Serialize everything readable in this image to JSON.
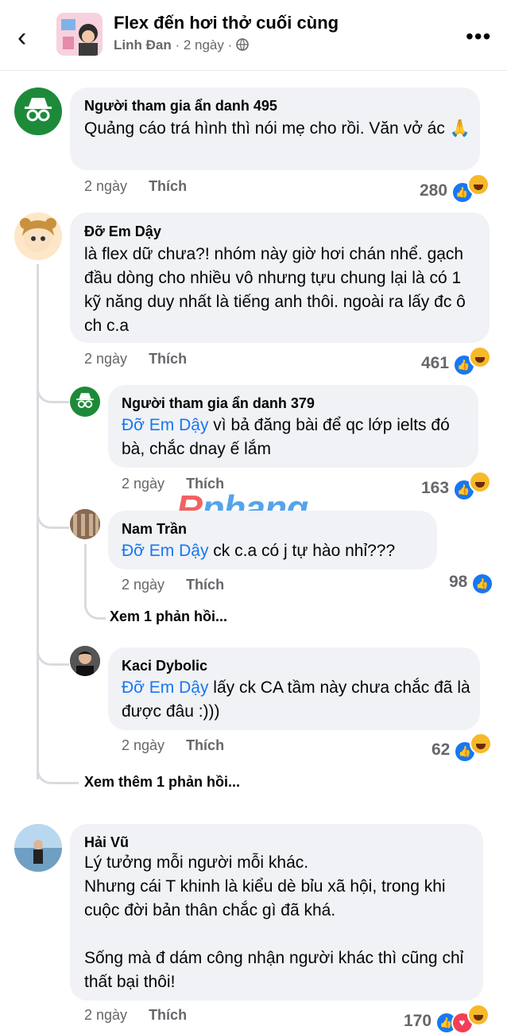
{
  "header": {
    "group_title": "Flex đến hơi thở cuối cùng",
    "author": "Linh Đan",
    "time": "· 2 ngày ·",
    "back_icon": "back-icon",
    "more_icon": "more-icon"
  },
  "comments": [
    {
      "name": "Người tham gia ẩn danh 495",
      "text": "Quảng cáo trá hình thì nói mẹ cho rồi. Văn vở ác 🙏",
      "time": "2 ngày",
      "like_label": "Thích",
      "count": "280"
    },
    {
      "name": "Đỡ Em Dậy",
      "text": "là flex dữ chưa?! nhóm này giờ hơi chán nhể. gạch đầu dòng cho nhiều vô nhưng tựu chung lại là có 1 kỹ năng duy nhất là tiếng anh thôi. ngoài ra lấy đc ô ch c.a",
      "time": "2 ngày",
      "like_label": "Thích",
      "count": "461"
    },
    {
      "name": "Người tham gia ẩn danh 379",
      "mention": "Đỡ Em Dậy",
      "text": " vì bả đăng bài để qc lớp ielts đó bà, chắc dnay ế lắm",
      "time": "2 ngày",
      "like_label": "Thích",
      "count": "163"
    },
    {
      "name": "Nam Trần",
      "mention": "Đỡ Em Dậy",
      "text": " ck c.a có j tự hào nhỉ???",
      "time": "2 ngày",
      "like_label": "Thích",
      "count": "98",
      "see_replies": "Xem 1 phản hồi..."
    },
    {
      "name": "Kaci Dybolic",
      "mention": "Đỡ Em Dậy",
      "text": " lấy ck CA tầm này chưa chắc đã là được đâu :)))",
      "time": "2 ngày",
      "like_label": "Thích",
      "count": "62"
    },
    {
      "see_more_replies": "Xem thêm 1 phản hồi..."
    },
    {
      "name": "Hải Vũ",
      "text_lines": [
        "Lý tưởng mỗi người mỗi khác.",
        "Nhưng cái T khinh là kiểu dè bỉu xã hội, trong khi cuộc đời bản thân chắc gì đã khá.",
        "",
        "Sống mà đ dám công nhận người khác thì cũng chỉ thất bại thôi!"
      ],
      "time": "2 ngày",
      "like_label": "Thích",
      "count": "170"
    }
  ],
  "watermark": {
    "first": "R",
    "rest": "phang"
  },
  "colors": {
    "link": "#1877f2",
    "bubble": "#f0f2f5",
    "meta": "#65676b"
  }
}
